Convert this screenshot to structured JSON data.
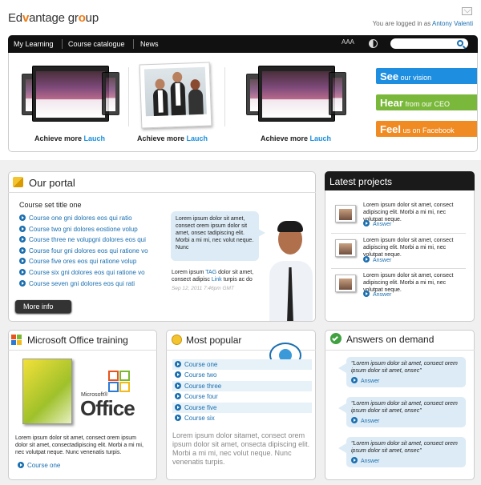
{
  "header": {
    "logo_pre": "Ed",
    "logo_o": "v",
    "logo_post": "antage gr",
    "logo_o2": "o",
    "logo_end": "up",
    "logged_prefix": "You are logged in as",
    "user": "Antony Valenti"
  },
  "nav": {
    "items": [
      "My Learning",
      "Course catalogue",
      "News"
    ],
    "font_size_label": "AAA",
    "search_placeholder": ""
  },
  "hero": {
    "captions": [
      {
        "text": "Achieve more",
        "link": "Lauch"
      },
      {
        "text": "Achieve more",
        "link": "Lauch"
      },
      {
        "text": "Achieve more",
        "link": "Lauch"
      }
    ],
    "cta": [
      {
        "bold": "See",
        "rest": "our vision",
        "color": "#1e8fe0"
      },
      {
        "bold": "Hear",
        "rest": "from our CEO",
        "color": "#79b83a"
      },
      {
        "bold": "Feel",
        "rest": "us on Facebook",
        "color": "#f08a22"
      }
    ]
  },
  "portal": {
    "title": "Our portal",
    "set_title": "Course set title one",
    "courses": [
      "Course one gni dolores eos qui ratio",
      "Course two gni dolores eostione volup",
      "Course three ne volupgni dolores eos qui",
      "Course four gni dolores eos qui ratione vo",
      "Course five ores eos qui ratione volup",
      "Course six gni dolores eos qui ratione vo",
      "Course seven gni dolores eos qui rati"
    ],
    "bubble": "Lorem ipsum dolor sit amet, consect orem ipsum dolor sit amet, onsec tadipiscing elit. Morbi a mi mi, nec volut neque. Nunc",
    "post_pre": "Lorem ipsum",
    "post_tag": "TAG",
    "post_mid": "dolor sit amet, consect adipisc",
    "post_link": "Link",
    "post_end": "turpis ac do",
    "date": "Sep 12, 2011 7:46pm GMT",
    "more": "More info"
  },
  "projects": {
    "title": "Latest projects",
    "items": [
      {
        "text": "Lorem ipsum dolor sit amet, consect adipiscing elit. Morbi a mi mi, nec volutpat neque.",
        "link": "Answer"
      },
      {
        "text": "Lorem ipsum dolor sit amet, consect adipiscing elit. Morbi a mi mi, nec volutpat neque.",
        "link": "Answer"
      },
      {
        "text": "Lorem ipsum dolor sit amet, consect adipiscing elit. Morbi a mi mi, nec volutpat neque.",
        "link": "Answer"
      }
    ]
  },
  "office": {
    "title": "Microsoft Office training",
    "ms": "Microsoft®",
    "word": "Office",
    "text": "Lorem ipsum dolor sit amet, consect orem ipsum dolor sit amet, consectadipiscing elit. Morbi a mi mi, nec volutpat neque. Nunc venenatis turpis.",
    "link": "Course one"
  },
  "popular": {
    "title": "Most popular",
    "items": [
      "Course one",
      "Course two",
      "Course three",
      "Course four",
      "Course five",
      "Course six"
    ],
    "text": "Lorem ipsum dolor sitamet, consect orem ipsum dolor sit amet, onsecta dipiscing elit. Morbi a mi mi, nec volut neque. Nunc venenatis turpis."
  },
  "answers": {
    "title": "Answers on demand",
    "items": [
      {
        "text": "\"Lorem ipsum dolor sit amet, consect orem ipsum dolor sit amet, onsec\"",
        "link": "Answer"
      },
      {
        "text": "\"Lorem ipsum dolor sit amet, consect orem ipsum dolor sit amet, onsec\"",
        "link": "Answer"
      },
      {
        "text": "\"Lorem ipsum dolor sit amet, consect orem ipsum dolor sit amet, onsec\"",
        "link": "Answer"
      }
    ]
  }
}
